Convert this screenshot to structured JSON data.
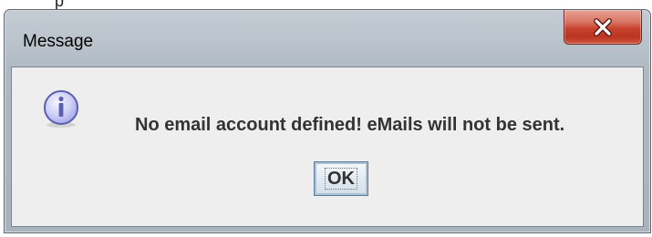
{
  "window": {
    "title": "Message",
    "close_icon": "close-icon"
  },
  "top_fragment": "p",
  "dialog": {
    "icon": "info-icon",
    "message": "No email account defined! eMails will not be sent.",
    "ok_label": "OK"
  },
  "colors": {
    "frame": "#b9c2cb",
    "close_button": "#c8432e",
    "content_bg": "#eeeeee",
    "icon_fill": "#c9cbf5",
    "icon_stroke": "#5a5fb0"
  }
}
